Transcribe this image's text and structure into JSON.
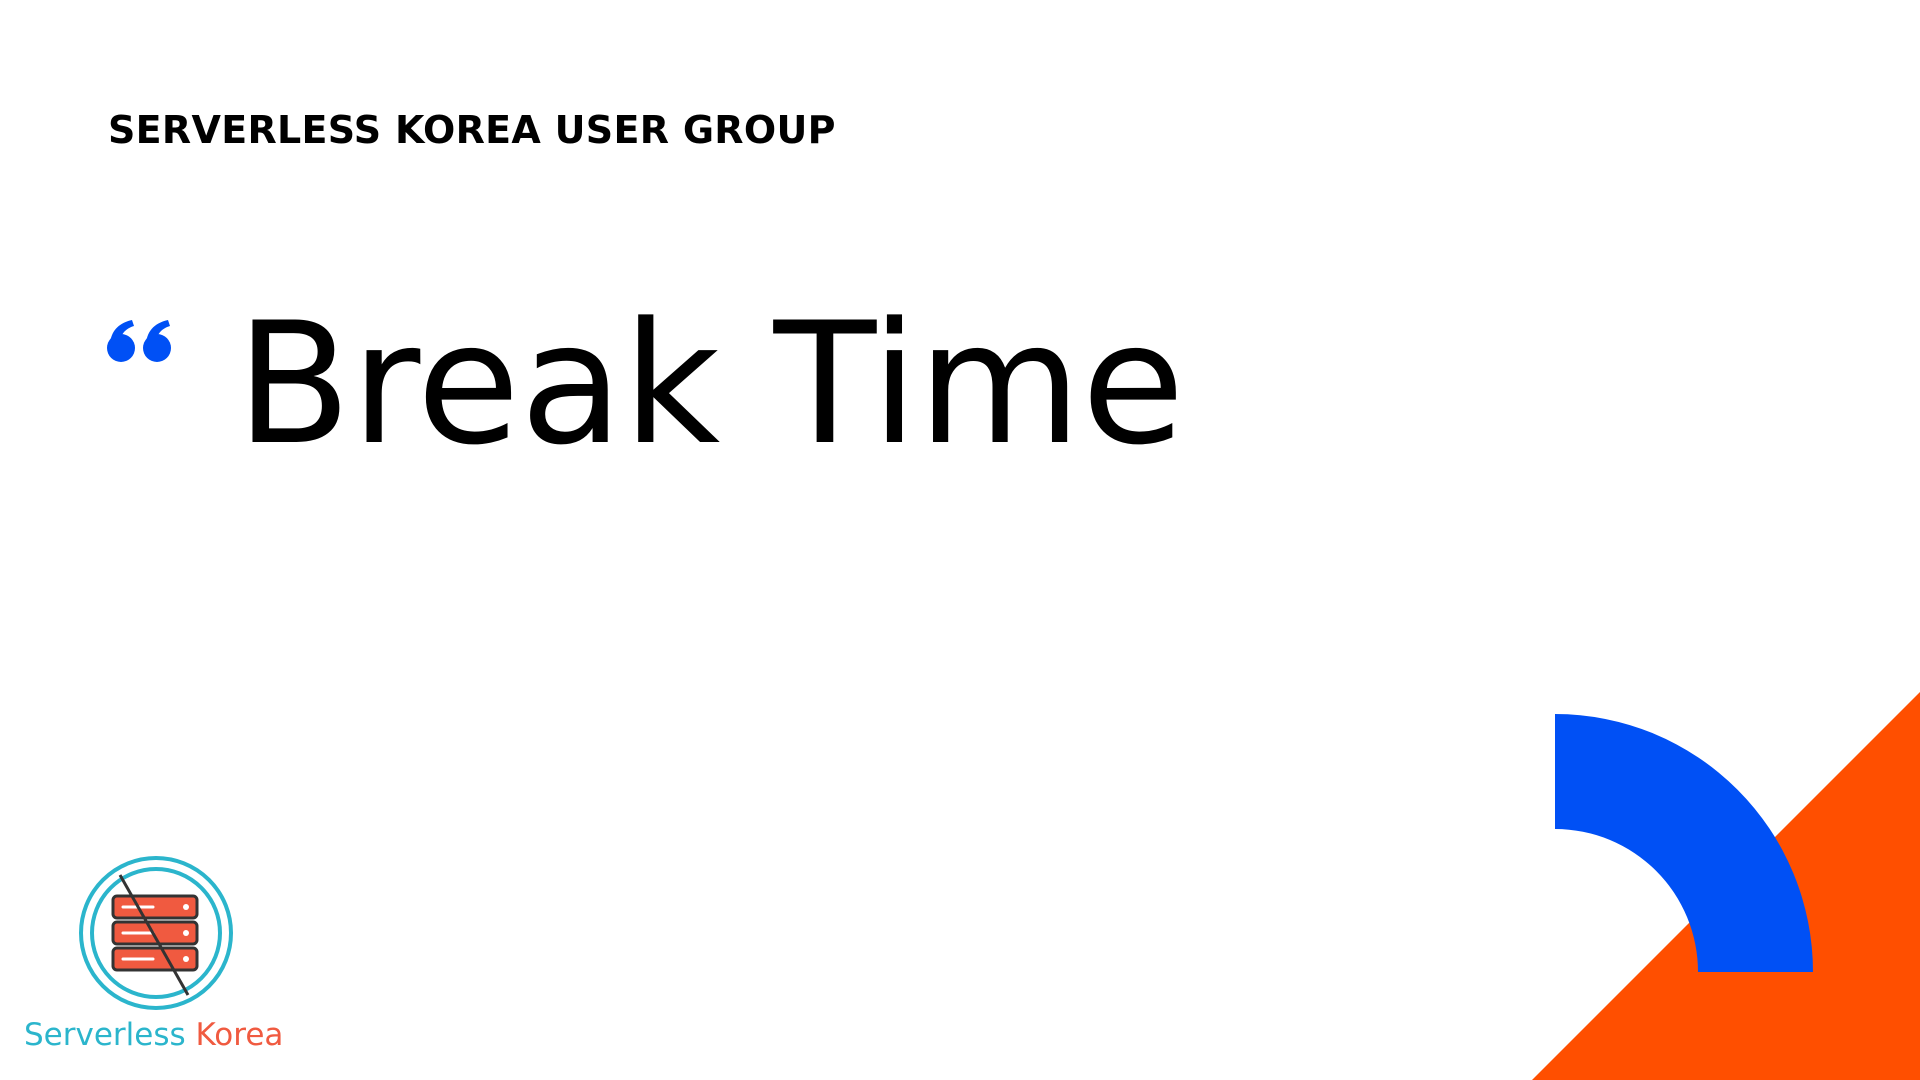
{
  "slide": {
    "header": "SERVERLESS KOREA USER GROUP",
    "title": "Break Time"
  },
  "logo": {
    "word1": "Serverless",
    "word2": "Korea",
    "primary_color": "#2bb5cc",
    "accent_color": "#f05a40"
  },
  "icons": {
    "quote": "opening-quote-icon",
    "logo_emblem": "server-stack-crossed-icon"
  },
  "colors": {
    "accent_blue": "#0050f5",
    "accent_orange": "#ff4f00",
    "text": "#000000",
    "background": "#ffffff"
  }
}
